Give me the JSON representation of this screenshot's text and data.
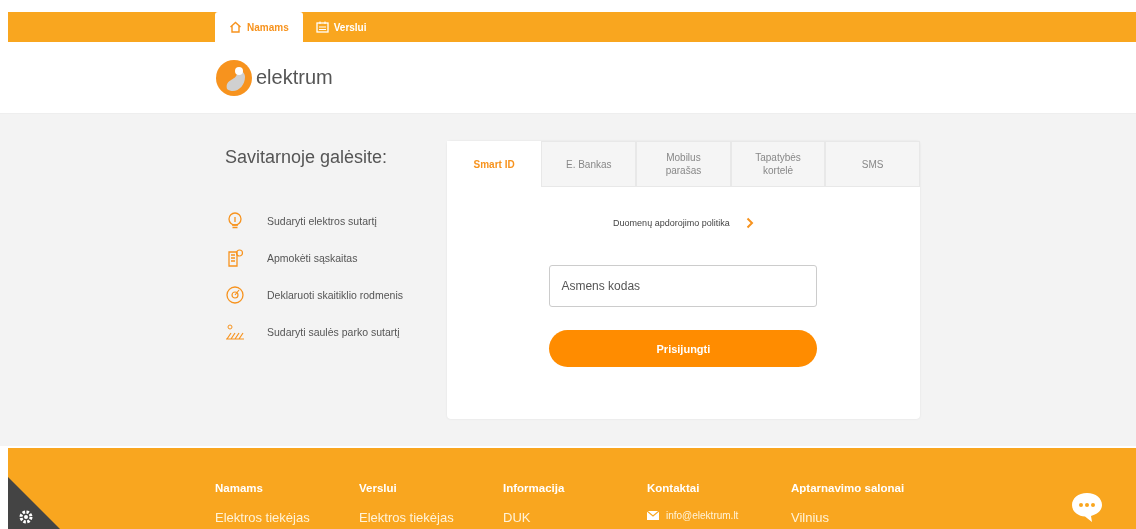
{
  "top_tabs": [
    {
      "label": "Namams",
      "kind": "home",
      "selected": true
    },
    {
      "label": "Verslui",
      "kind": "calendar",
      "selected": false
    }
  ],
  "logo": {
    "text": "elektrum"
  },
  "features": {
    "title": "Savitarnoje galėsite:",
    "items": [
      {
        "kind": "bulb",
        "label": "Sudaryti elektros sutartį"
      },
      {
        "kind": "bill",
        "label": "Apmokėti sąskaitas"
      },
      {
        "kind": "meter",
        "label": "Deklaruoti skaitiklio rodmenis"
      },
      {
        "kind": "solar",
        "label": "Sudaryti saulės parko sutartį"
      }
    ]
  },
  "login": {
    "tabs": [
      {
        "label": "Smart ID",
        "selected": true
      },
      {
        "label": "E. Bankas",
        "selected": false
      },
      {
        "label": "Mobilus parašas",
        "selected": false
      },
      {
        "label": "Tapatybės kortelė",
        "selected": false
      },
      {
        "label": "SMS",
        "selected": false
      }
    ],
    "policy_link": "Duomenų apdorojimo politika",
    "input": {
      "placeholder": "Asmens kodas"
    },
    "submit": "Prisijungti"
  },
  "footer": {
    "columns": [
      {
        "heading": "Namams",
        "first": "Elektros tiekėjas",
        "kind": "text"
      },
      {
        "heading": "Verslui",
        "first": "Elektros tiekėjas",
        "kind": "text"
      },
      {
        "heading": "Informacija",
        "first": "DUK",
        "kind": "text"
      },
      {
        "heading": "Kontaktai",
        "first": "info@elektrum.lt",
        "kind": "email"
      },
      {
        "heading": "Aptarnavimo salonai",
        "first": "Vilnius",
        "kind": "text"
      }
    ]
  }
}
